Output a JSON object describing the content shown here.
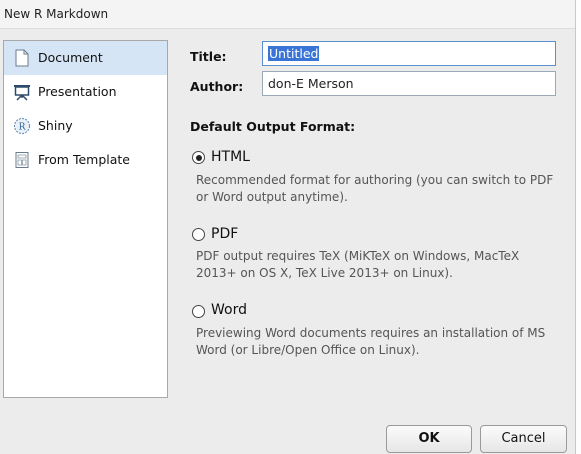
{
  "window": {
    "title": "New R Markdown"
  },
  "sidebar": {
    "items": [
      {
        "label": "Document",
        "icon": "document-icon",
        "selected": true
      },
      {
        "label": "Presentation",
        "icon": "presentation-icon",
        "selected": false
      },
      {
        "label": "Shiny",
        "icon": "shiny-icon",
        "selected": false
      },
      {
        "label": "From Template",
        "icon": "template-icon",
        "selected": false
      }
    ]
  },
  "form": {
    "title_label": "Title:",
    "title_value": "Untitled",
    "author_label": "Author:",
    "author_value": "don-E Merson"
  },
  "output": {
    "heading": "Default Output Format:",
    "options": [
      {
        "label": "HTML",
        "selected": true,
        "desc_line1": "Recommended format for authoring (you can switch to PDF",
        "desc_line2": "or Word output anytime)."
      },
      {
        "label": "PDF",
        "selected": false,
        "desc_line1": "PDF output requires TeX (MiKTeX on Windows, MacTeX",
        "desc_line2": "2013+ on OS X, TeX Live 2013+ on Linux)."
      },
      {
        "label": "Word",
        "selected": false,
        "desc_line1": "Previewing Word documents requires an installation of MS",
        "desc_line2": "Word (or Libre/Open Office on Linux)."
      }
    ]
  },
  "buttons": {
    "ok": "OK",
    "cancel": "Cancel"
  },
  "colors": {
    "selection": "#3875d7",
    "sidebar_selected": "#d6e5f5"
  }
}
